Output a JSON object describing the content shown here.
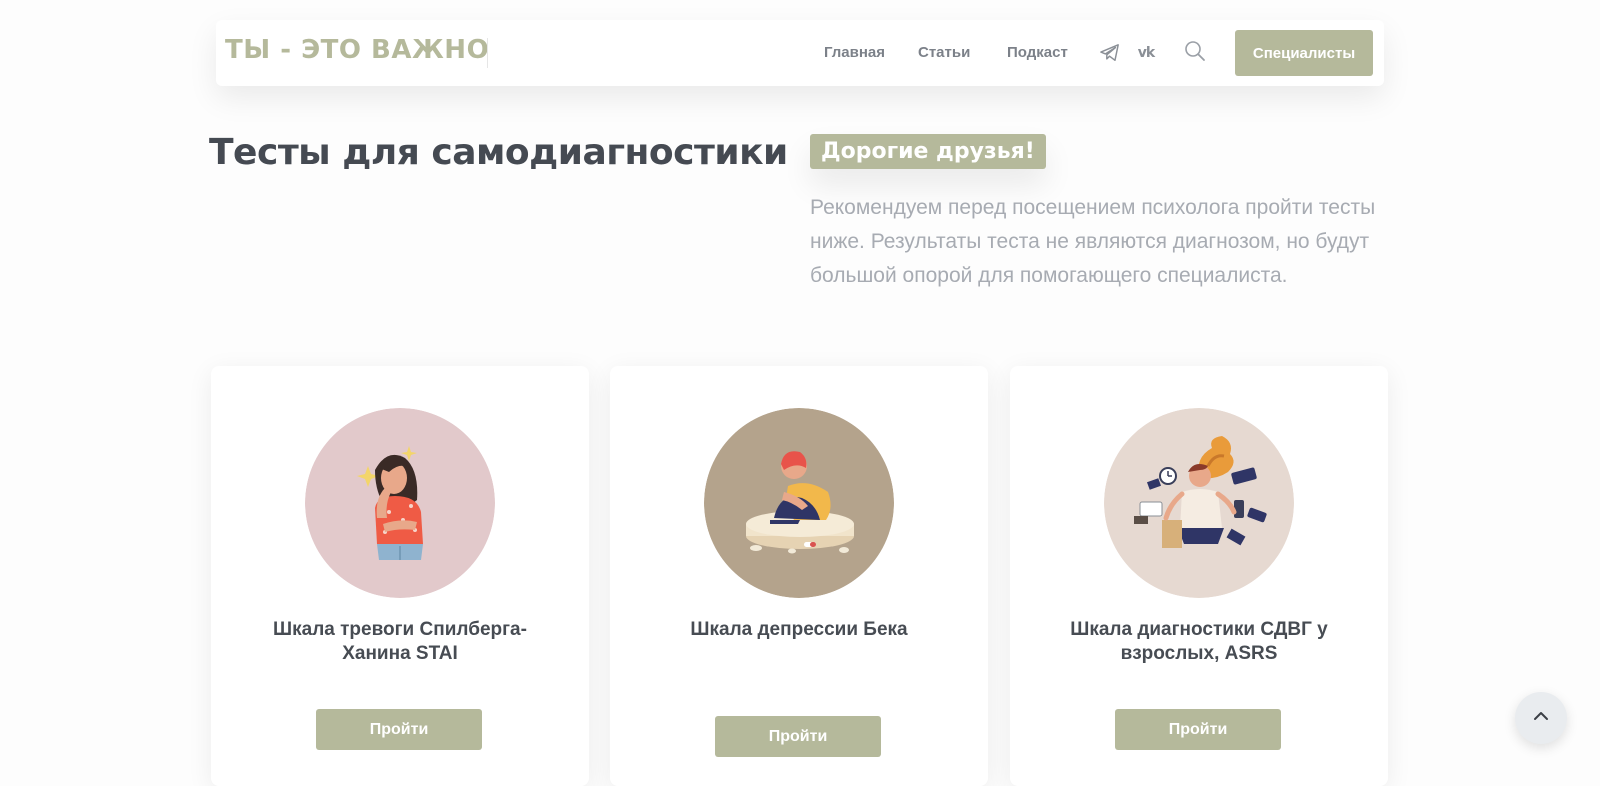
{
  "header": {
    "logo": "ТЫ - ЭТО ВАЖНО",
    "nav": [
      {
        "label": "Главная"
      },
      {
        "label": "Статьи"
      },
      {
        "label": "Подкаст"
      }
    ],
    "vk_label": "vk",
    "specialists_label": "Специалисты",
    "icons": [
      "telegram-icon",
      "vk-icon",
      "search-icon"
    ]
  },
  "intro": {
    "title": "Тесты для самодиагностики",
    "badge": "Дорогие друзья!",
    "text": "Рекомендуем перед посещением психолога пройти тесты ниже. Результаты теста не являются диагнозом, но будут большой опорой для помогающего специалиста."
  },
  "cards": [
    {
      "title": "Шкала тревоги Спилберга-Ханина STAI",
      "button": "Пройти",
      "image_bg": "#e2c9cb"
    },
    {
      "title": "Шкала депрессии Бека",
      "button": "Пройти",
      "image_bg": "#b4a38c"
    },
    {
      "title": "Шкала диагностики СДВГ у взрослых, ASRS",
      "button": "Пройти",
      "image_bg": "#e6d9d1"
    }
  ],
  "colors": {
    "accent": "#b5b99b",
    "title": "#454a52",
    "muted_text": "#a7abb2",
    "nav_text": "#7c8189"
  }
}
